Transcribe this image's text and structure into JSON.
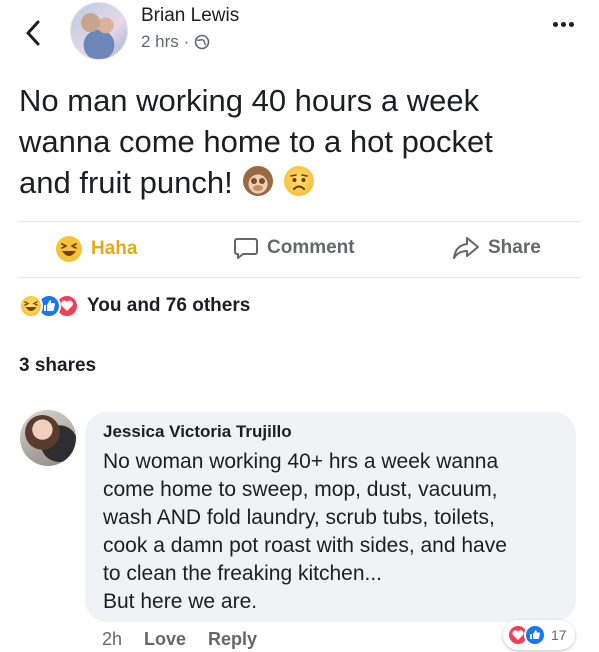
{
  "post": {
    "author": "Brian Lewis",
    "time": "2 hrs",
    "separator": "·",
    "text_line1": "No man working 40 hours a week",
    "text_line2": "wanna come home to a hot pocket",
    "text_line3": "and fruit punch!",
    "inline_emojis": [
      "see-no-evil-monkey",
      "worried-face"
    ]
  },
  "actions": {
    "haha": "Haha",
    "comment": "Comment",
    "share": "Share"
  },
  "reactions": {
    "icons": [
      "haha",
      "like",
      "love"
    ],
    "summary": "You and 76 others"
  },
  "shares": "3 shares",
  "comment": {
    "author": "Jessica Victoria Trujillo",
    "lines": [
      "No woman working 40+ hrs a week wanna",
      "come home to sweep, mop, dust, vacuum,",
      "wash AND fold laundry, scrub tubs, toilets,",
      "cook a damn pot roast with sides, and have",
      "to clean the freaking kitchen...",
      "But here we are."
    ],
    "time": "2h",
    "love_label": "Love",
    "reply_label": "Reply",
    "reaction_count": "17"
  },
  "colors": {
    "haha": "#e6a81c",
    "like": "#1877f2",
    "love": "#f33e58",
    "bubble": "#f0f2f5"
  }
}
